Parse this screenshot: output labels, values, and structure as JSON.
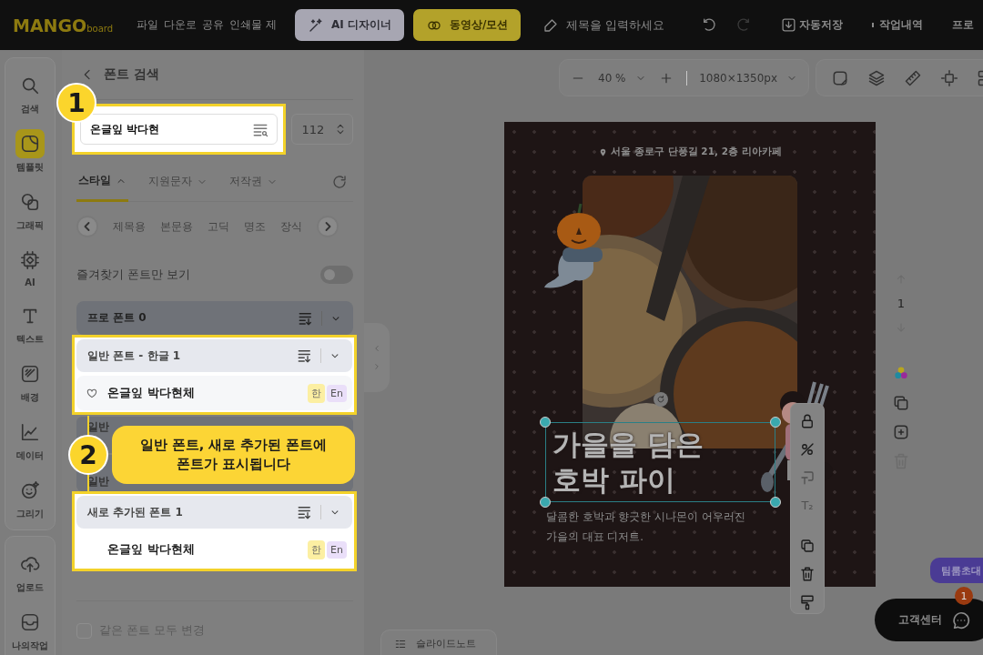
{
  "top_bar": {
    "logo": {
      "main": "MANGO",
      "sub": "board"
    },
    "menu": [
      "파일",
      "다운로",
      "공유",
      "인쇄물 제"
    ],
    "buttons": [
      {
        "label": "AI 디자이너",
        "kind": "ai"
      },
      {
        "label": "동영상/모션",
        "kind": "video"
      }
    ],
    "title_field": {
      "placeholder": "제목을 입력하세요"
    },
    "actions": [
      {
        "label": "자동저장",
        "kind": "save"
      },
      {
        "label": "작업내역",
        "kind": "history"
      },
      {
        "label": "프로",
        "kind": "plain"
      }
    ]
  },
  "sidebar": {
    "items": [
      {
        "label": "검색",
        "kind": "search",
        "selected": false
      },
      {
        "label": "템플릿",
        "kind": "template",
        "selected": true
      },
      {
        "label": "그래픽",
        "kind": "graphic",
        "selected": false
      },
      {
        "label": "AI",
        "kind": "ai",
        "selected": false
      },
      {
        "label": "텍스트",
        "kind": "text",
        "selected": false
      },
      {
        "label": "배경",
        "kind": "background",
        "selected": false
      },
      {
        "label": "데이터",
        "kind": "chart",
        "selected": false
      },
      {
        "label": "그리기",
        "kind": "draw",
        "selected": false
      }
    ],
    "bottom_items": [
      {
        "label": "업로드",
        "kind": "upload",
        "selected": false
      },
      {
        "label": "나의작업",
        "kind": "work",
        "selected": false
      }
    ]
  },
  "font_panel": {
    "title": "폰트 검색",
    "search": {
      "value": "온글잎 박다현"
    },
    "size": {
      "value": "112"
    },
    "filter_tabs": [
      {
        "label": "스타일",
        "selected": true,
        "expanded": true
      },
      {
        "label": "지원문자",
        "selected": false,
        "expanded": false
      },
      {
        "label": "저작권",
        "selected": false,
        "expanded": false
      }
    ],
    "categories": [
      "제목용",
      "본문용",
      "고딕",
      "명조",
      "장식"
    ],
    "favorites_toggle": {
      "label": "즐겨찾기 폰트만 보기",
      "on": false
    },
    "sections": [
      {
        "title": "프로 폰트 0",
        "kind": "header",
        "highlighted": false
      },
      {
        "title": "일반 폰트 - 한글 1",
        "kind": "header",
        "highlighted": true,
        "fonts": [
          {
            "name": "온글잎 박다현체",
            "favorited": false,
            "tags": [
              "한",
              "En"
            ]
          }
        ]
      },
      {
        "title": "일반",
        "kind": "covered",
        "highlighted": false
      },
      {
        "title": "일반",
        "kind": "covered",
        "highlighted": false
      },
      {
        "title": "새로 추가된 폰트 1",
        "kind": "header",
        "highlighted": true,
        "fonts": [
          {
            "name": "온글잎 박다현체",
            "tags": [
              "한",
              "En"
            ]
          }
        ]
      }
    ],
    "same_font_checkbox": {
      "label": "같은 폰트 모두 변경",
      "checked": false
    }
  },
  "tutorial": {
    "steps": [
      {
        "number": "1"
      },
      {
        "number": "2",
        "text": "일반 폰트, 새로 추가된 폰트에\n폰트가 표시됩니다"
      }
    ]
  },
  "canvas_toolbar": {
    "zoom": "40 %",
    "page_size": "1080×1350px"
  },
  "page_nav": {
    "page": "1"
  },
  "design": {
    "address": "서울 종로구 단풍길 21, 2층 리아카페",
    "title": "가을을 담은\n호박 파이",
    "subtitle": "달콤한 호박과 향긋한 시나몬이 어우러진\n가을의 대표 디저트."
  },
  "element_tools": [
    {
      "kind": "lock",
      "disabled": false
    },
    {
      "kind": "unlink",
      "disabled": false
    },
    {
      "kind": "textbox",
      "disabled": true
    },
    {
      "kind": "subscript",
      "label": "T₂",
      "disabled": true
    },
    {
      "kind": "divider"
    },
    {
      "kind": "copy",
      "disabled": false
    },
    {
      "kind": "delete",
      "disabled": false
    },
    {
      "kind": "paint",
      "disabled": false
    }
  ],
  "page_tools": [
    {
      "kind": "color"
    },
    {
      "kind": "copy",
      "disabled": false
    },
    {
      "kind": "add",
      "disabled": false
    },
    {
      "kind": "delete",
      "disabled": true
    }
  ],
  "slide_note_tab": {
    "label": "슬라이드노트"
  },
  "invite_bubble": {
    "label": "팀룸초대"
  },
  "help_button": {
    "label": "고객센터",
    "badge": "1"
  }
}
